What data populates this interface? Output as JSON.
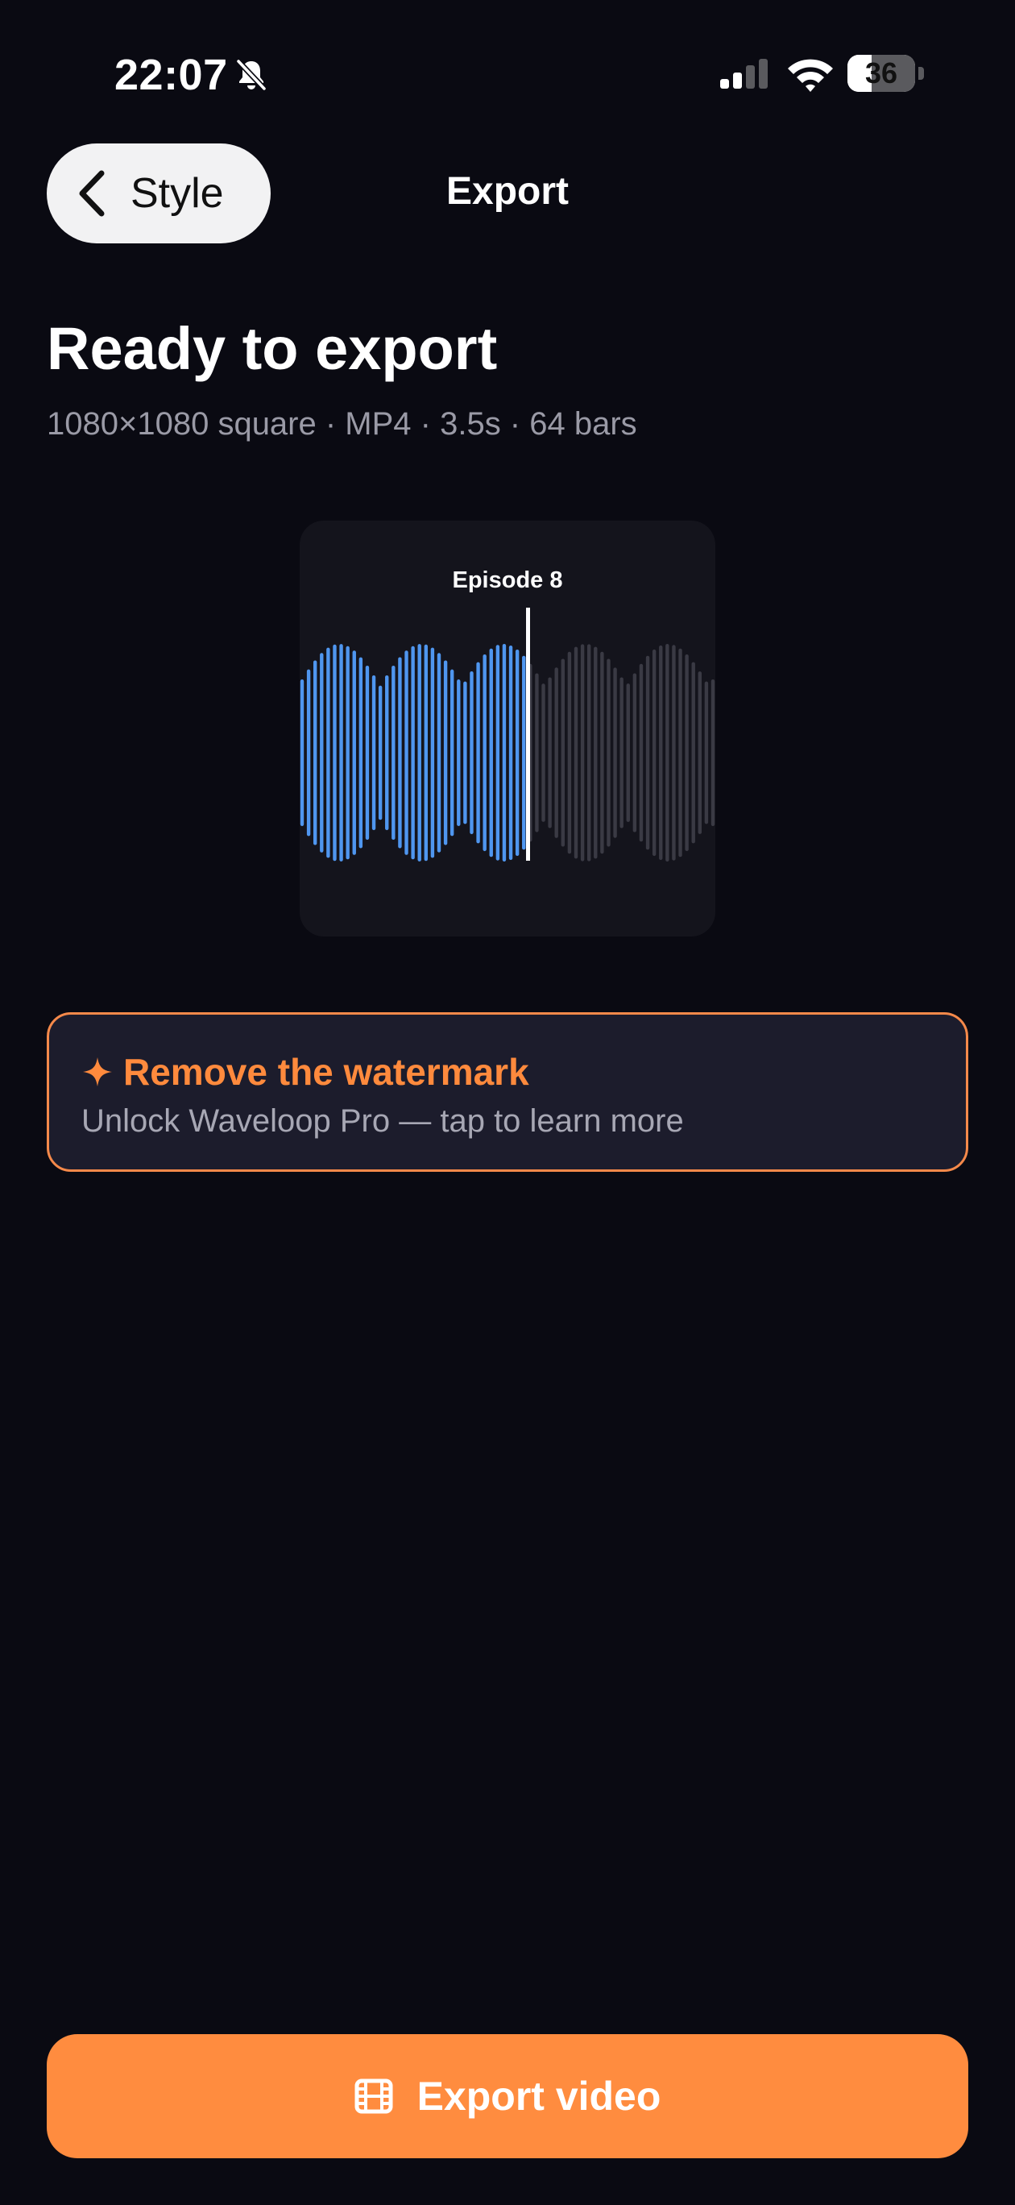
{
  "status_bar": {
    "time": "22:07",
    "battery_level": "36",
    "battery_fraction": 0.36,
    "icons": [
      "bell-slash-icon",
      "cellular-signal-icon",
      "wifi-icon",
      "battery-icon"
    ]
  },
  "nav": {
    "back_label": "Style",
    "back_icon": "chevron-left-icon",
    "title": "Export"
  },
  "header": {
    "title": "Ready to export",
    "subtitle": "1080×1080 square · MP4 · 3.5s · 64 bars"
  },
  "preview": {
    "title": "Episode 8",
    "bar_count": 64,
    "playhead_fraction": 0.55,
    "played_color": "#4f96ef",
    "unplayed_color": "#3a3a44",
    "playhead_color": "#ffffff"
  },
  "pro_banner": {
    "icon": "sparkle-icon",
    "title": "Remove the watermark",
    "subtitle": "Unlock Waveloop Pro — tap to learn more",
    "accent_color": "#ff8a3d"
  },
  "export": {
    "label": "Export video",
    "icon": "film-icon",
    "color": "#ff8c3f"
  }
}
